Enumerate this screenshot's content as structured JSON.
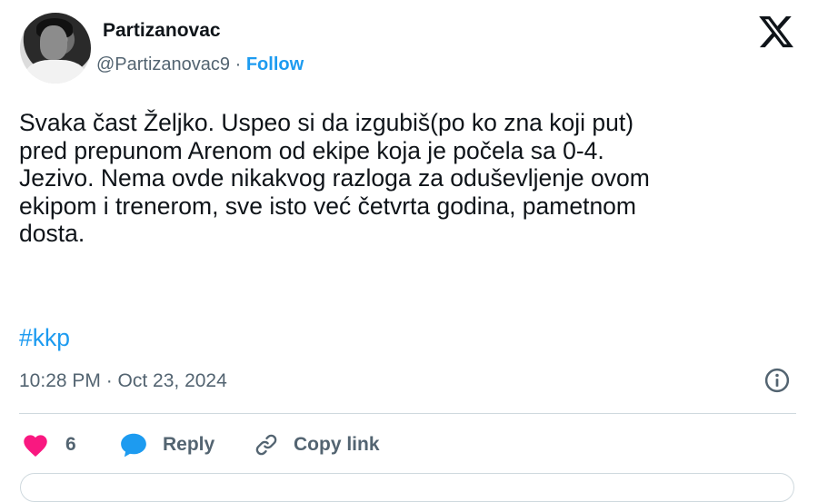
{
  "author": {
    "name": "Partizanovac",
    "handle": "@Partizanovac9",
    "separator": "·",
    "follow_label": "Follow"
  },
  "tweet": {
    "text": "Svaka čast Željko. Uspeo si da izgubiš(po ko zna koji put)\npred prepunom Arenom od ekipe koja je počela sa 0-4.\nJezivo. Nema ovde nikakvog razloga za oduševljenje ovom\nekipom i trenerom, sve isto već četvrta godina, pametnom\ndosta.",
    "hashtag": "#kkp",
    "timestamp": "10:28 PM · Oct 23, 2024"
  },
  "actions": {
    "like_count": "6",
    "reply_label": "Reply",
    "copy_link_label": "Copy link"
  },
  "icons": {
    "platform": "x-logo-icon",
    "info": "info-icon",
    "like": "heart-icon",
    "reply": "speech-bubble-icon",
    "copy": "link-icon"
  },
  "colors": {
    "accent": "#1d9bf0",
    "heart": "#f91880",
    "text": "#0f1419",
    "muted": "#536471",
    "border": "#cfd9de"
  }
}
